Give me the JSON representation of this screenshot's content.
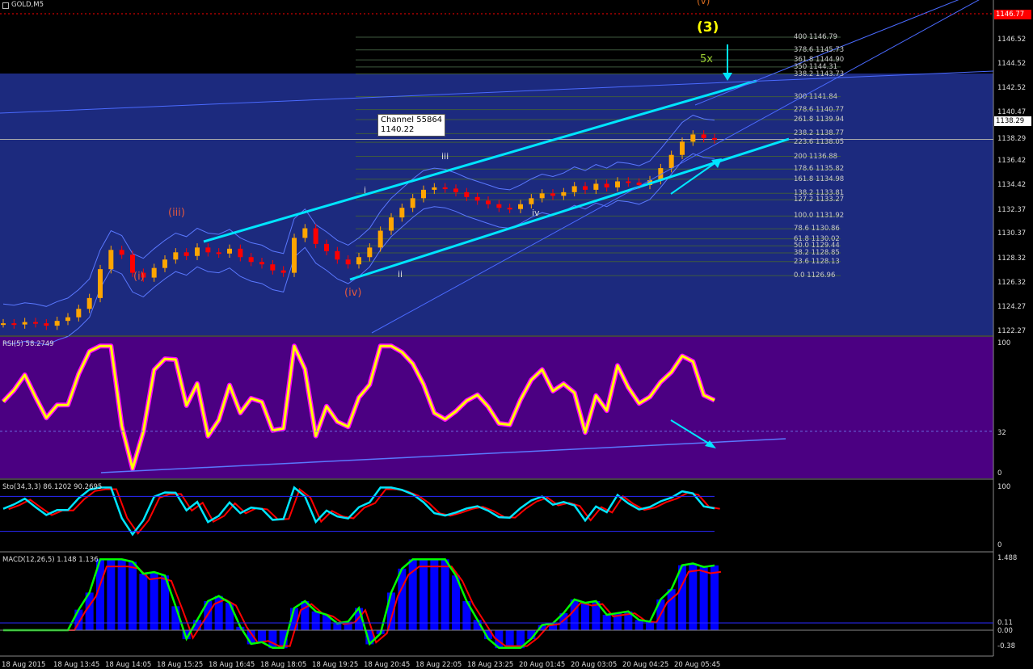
{
  "window": {
    "title": "GOLD,M5"
  },
  "colors": {
    "background": "#000000",
    "price_band": "#1c2a7e",
    "rsi_band": "#4b0082",
    "bull_candle": "#ffa500",
    "bear_candle": "#ff0000",
    "channel": "#00e5ff",
    "fib_line": "#3f5a3f",
    "rsi_main": "#ffff00",
    "rsi_glow": "#ff00ff",
    "stoch_main": "#00e5ff",
    "stoch_signal": "#ff0000",
    "macd_hist": "#0000ff",
    "macd_line": "#00ff00",
    "macd_signal": "#ff0000",
    "last_price_bg": "#ff0000"
  },
  "price_axis": {
    "labels": [
      "1146.52",
      "1144.52",
      "1142.52",
      "1140.47",
      "1138.29",
      "1136.42",
      "1134.42",
      "1132.37",
      "1130.37",
      "1128.32",
      "1126.32",
      "1124.27",
      "1122.27"
    ],
    "current_price": "1138.29",
    "alert_price": "1146.77"
  },
  "fib_levels": [
    {
      "label": "400 1146.79"
    },
    {
      "label": "378.6 1145.73"
    },
    {
      "label": "361.8 1144.90"
    },
    {
      "label": "350 1144.31"
    },
    {
      "label": "338.2 1143.73"
    },
    {
      "label": "300 1141.84"
    },
    {
      "label": "278.6 1140.77"
    },
    {
      "label": "261.8 1139.94"
    },
    {
      "label": "238.2 1138.77"
    },
    {
      "label": "223.6 1138.05"
    },
    {
      "label": "200 1136.88"
    },
    {
      "label": "178.6 1135.82"
    },
    {
      "label": "161.8 1134.98"
    },
    {
      "label": "138.2 1133.81"
    },
    {
      "label": "127.2 1133.27"
    },
    {
      "label": "100.0 1131.92"
    },
    {
      "label": "78.6 1130.86"
    },
    {
      "label": "61.8 1130.02"
    },
    {
      "label": "50.0 1129.44"
    },
    {
      "label": "38.2 1128.85"
    },
    {
      "label": "23.6 1128.13"
    },
    {
      "label": "0.0 1126.96"
    }
  ],
  "annotations": {
    "channel_tooltip_line1": "Channel 55864",
    "channel_tooltip_line2": "1140.22",
    "wave_top": "(v)",
    "wave_3": "(3)",
    "wave_5x": "5x",
    "wave_iii_big": "(iii)",
    "wave_i_big": "(i)",
    "wave_iv_big": "(iv)",
    "wave_i": "i",
    "wave_ii": "ii",
    "wave_iii": "iii",
    "wave_iv": "iv"
  },
  "rsi": {
    "title": "RSI(5) 58.2749",
    "axis": [
      "100",
      "32",
      "0"
    ]
  },
  "stoch": {
    "title": "Sto(34,3,3) 86.1202 90.2695",
    "axis": [
      "100",
      "0"
    ]
  },
  "macd": {
    "title": "MACD(12,26,5) 1.148 1.136",
    "axis": [
      "1.488",
      "0.11",
      "0.00",
      "-0.38"
    ]
  },
  "time_axis": [
    "18 Aug 2015",
    "18 Aug 13:45",
    "18 Aug 14:05",
    "18 Aug 15:25",
    "18 Aug 16:45",
    "18 Aug 18:05",
    "18 Aug 19:25",
    "18 Aug 20:45",
    "18 Aug 22:05",
    "18 Aug 23:25",
    "20 Aug 01:45",
    "20 Aug 03:05",
    "20 Aug 04:25",
    "20 Aug 05:45"
  ],
  "chart_data": {
    "type": "line",
    "symbol": "GOLD",
    "timeframe": "M5",
    "price_ylim": [
      1122.27,
      1146.52
    ],
    "close_series": [
      1123.0,
      1122.9,
      1123.1,
      1123.0,
      1122.8,
      1123.2,
      1123.5,
      1124.2,
      1125.1,
      1127.5,
      1129.1,
      1128.7,
      1127.2,
      1126.8,
      1127.6,
      1128.3,
      1128.9,
      1128.6,
      1129.3,
      1128.9,
      1128.8,
      1129.2,
      1128.5,
      1128.1,
      1127.9,
      1127.4,
      1127.2,
      1130.1,
      1130.9,
      1129.6,
      1129.0,
      1128.3,
      1127.9,
      1128.5,
      1129.3,
      1130.7,
      1131.8,
      1132.6,
      1133.4,
      1134.1,
      1134.3,
      1134.2,
      1133.9,
      1133.5,
      1133.2,
      1132.9,
      1132.6,
      1132.5,
      1132.9,
      1133.4,
      1133.8,
      1133.6,
      1133.9,
      1134.4,
      1134.1,
      1134.6,
      1134.3,
      1134.8,
      1134.7,
      1134.5,
      1134.9,
      1135.9,
      1137.0,
      1138.1,
      1138.7,
      1138.4,
      1138.29
    ],
    "channel_value": 1140.22
  }
}
